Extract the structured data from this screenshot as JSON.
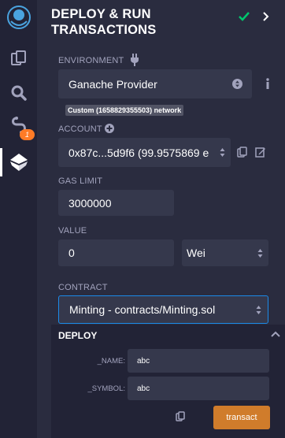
{
  "header": {
    "title": "DEPLOY & RUN TRANSACTIONS"
  },
  "rail": {
    "badge_count": "1"
  },
  "environment": {
    "label": "ENVIRONMENT",
    "value": "Ganache Provider",
    "network": "Custom (1658829355503) network"
  },
  "account": {
    "label": "ACCOUNT",
    "value": "0x87c...5d9f6 (99.9575869 e"
  },
  "gas_limit": {
    "label": "GAS LIMIT",
    "value": "3000000"
  },
  "value": {
    "label": "VALUE",
    "amount": "0",
    "unit": "Wei"
  },
  "contract": {
    "label": "CONTRACT",
    "value": "Minting - contracts/Minting.sol"
  },
  "deploy": {
    "title": "DEPLOY",
    "params": [
      {
        "label": "_NAME:",
        "value": "abc"
      },
      {
        "label": "_SYMBOL:",
        "value": "abc"
      }
    ],
    "transact_label": "transact"
  },
  "colors": {
    "accent": "#d07c2b",
    "success": "#00c76d",
    "badge": "#ff7b26",
    "focus": "#1b8be9"
  }
}
